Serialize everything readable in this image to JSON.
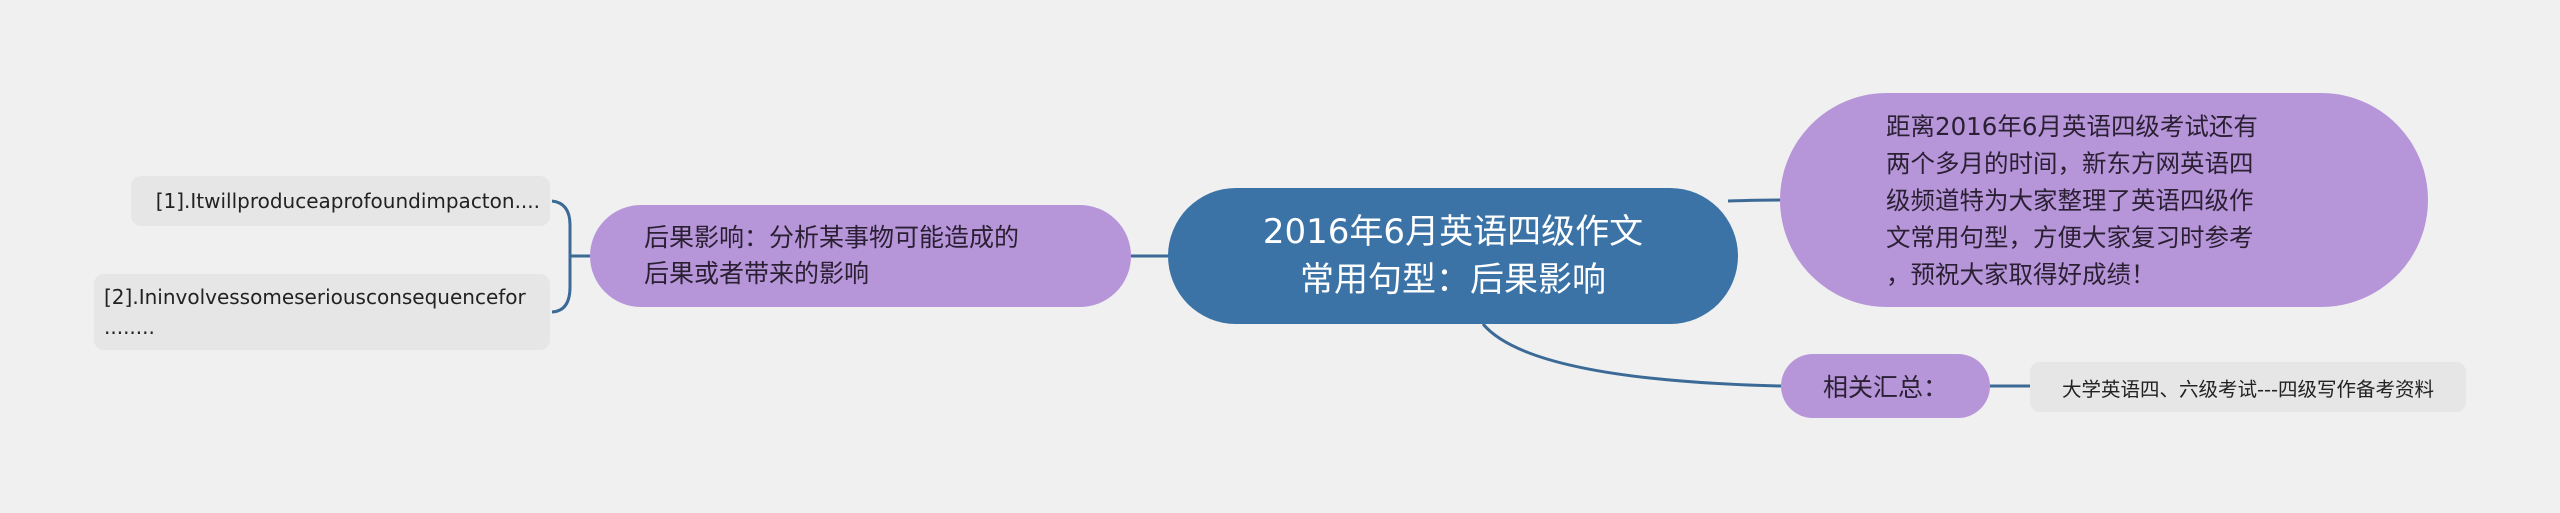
{
  "colors": {
    "background": "#f0f0f0",
    "central_node": "#3b73a6",
    "topic_node": "#b696d9",
    "leaf_node": "#e6e6e6",
    "connector": "#3b6a96"
  },
  "mindmap": {
    "central": {
      "text": "2016年6月英语四级作文\n常用句型：后果影响"
    },
    "left_branch": {
      "topic": {
        "text": "后果影响：分析某事物可能造成的\n后果或者带来的影响"
      },
      "leaves": [
        {
          "text": "[1].Itwillproduceaprofoundimpacton...."
        },
        {
          "text": "[2].Ininvolvessomeseriousconsequencefor\n........"
        }
      ]
    },
    "right_branches": {
      "intro": {
        "text": "距离2016年6月英语四级考试还有\n两个多月的时间，新东方网英语四\n级频道特为大家整理了英语四级作\n文常用句型，方便大家复习时参考\n，预祝大家取得好成绩！"
      },
      "summary": {
        "topic": {
          "text": "相关汇总："
        },
        "leaves": [
          {
            "text": "大学英语四、六级考试---四级写作备考资料"
          }
        ]
      }
    }
  }
}
